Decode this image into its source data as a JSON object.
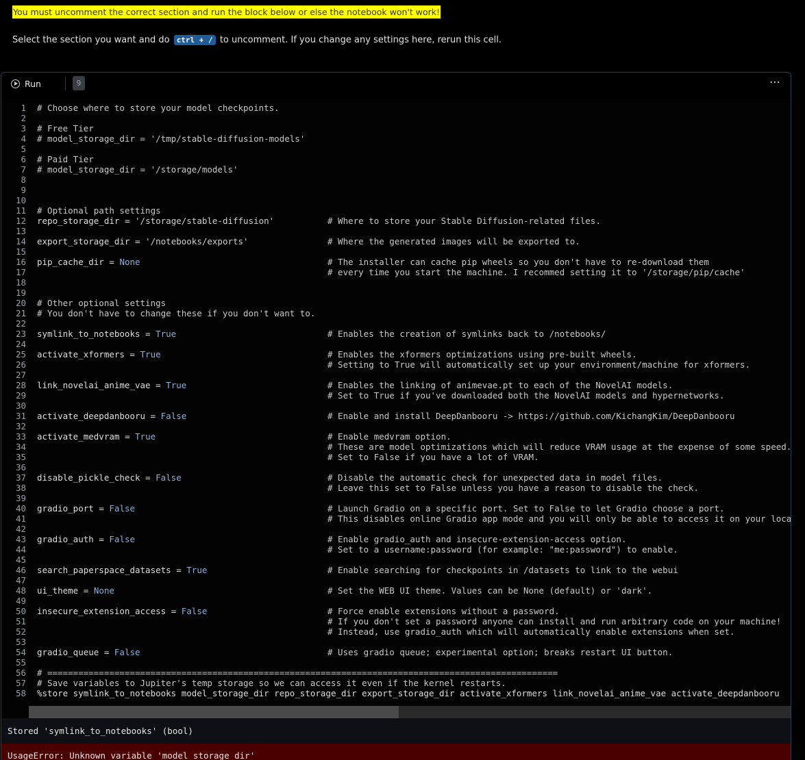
{
  "banner": "You must uncomment the correct section and run the block below or else the notebook won't work!",
  "instruction": {
    "before": "Select the section you want and do",
    "kbd": "ctrl + /",
    "after": "to uncomment. If you change any settings here, rerun this cell."
  },
  "cell": {
    "run_label": "Run",
    "exec_count": "9",
    "more_label": "⋯"
  },
  "code_lines": [
    {
      "n": "1",
      "code": "# Choose where to store your model checkpoints.",
      "type": "comment"
    },
    {
      "n": "2",
      "code": "",
      "type": "blank"
    },
    {
      "n": "3",
      "code": "# Free Tier",
      "type": "comment"
    },
    {
      "n": "4",
      "code": "# model_storage_dir = '/tmp/stable-diffusion-models'",
      "type": "comment"
    },
    {
      "n": "5",
      "code": "",
      "type": "blank"
    },
    {
      "n": "6",
      "code": "# Paid Tier",
      "type": "comment"
    },
    {
      "n": "7",
      "code": "# model_storage_dir = '/storage/models'",
      "type": "comment"
    },
    {
      "n": "8",
      "code": "",
      "type": "blank"
    },
    {
      "n": "9",
      "code": "",
      "type": "blank"
    },
    {
      "n": "10",
      "code": "",
      "type": "blank"
    },
    {
      "n": "11",
      "code": "# Optional path settings",
      "type": "comment"
    },
    {
      "n": "12",
      "code": "repo_storage_dir = '/storage/stable-diffusion'",
      "type": "assign",
      "comment": "# Where to store your Stable Diffusion-related files."
    },
    {
      "n": "13",
      "code": "",
      "type": "blank"
    },
    {
      "n": "14",
      "code": "export_storage_dir = '/notebooks/exports'",
      "type": "assign",
      "comment": "# Where the generated images will be exported to."
    },
    {
      "n": "15",
      "code": "",
      "type": "blank"
    },
    {
      "n": "16",
      "code": "pip_cache_dir = None",
      "type": "assign",
      "comment": "# The installer can cache pip wheels so you don't have to re-download them"
    },
    {
      "n": "17",
      "code": "",
      "type": "blank",
      "comment": "# every time you start the machine. I recommed setting it to '/storage/pip/cache'"
    },
    {
      "n": "18",
      "code": "",
      "type": "blank"
    },
    {
      "n": "19",
      "code": "",
      "type": "blank"
    },
    {
      "n": "20",
      "code": "# Other optional settings",
      "type": "comment"
    },
    {
      "n": "21",
      "code": "# You don't have to change these if you don't want to.",
      "type": "comment"
    },
    {
      "n": "22",
      "code": "",
      "type": "blank"
    },
    {
      "n": "23",
      "code": "symlink_to_notebooks = True",
      "type": "assign",
      "comment": "# Enables the creation of symlinks back to /notebooks/"
    },
    {
      "n": "24",
      "code": "",
      "type": "blank"
    },
    {
      "n": "25",
      "code": "activate_xformers = True",
      "type": "assign",
      "comment": "# Enables the xformers optimizations using pre-built wheels."
    },
    {
      "n": "26",
      "code": "",
      "type": "blank",
      "comment": "# Setting to True will automatically set up your environment/machine for xformers."
    },
    {
      "n": "27",
      "code": "",
      "type": "blank"
    },
    {
      "n": "28",
      "code": "link_novelai_anime_vae = True",
      "type": "assign",
      "comment": "# Enables the linking of animevae.pt to each of the NovelAI models."
    },
    {
      "n": "29",
      "code": "",
      "type": "blank",
      "comment": "# Set to True if you've downloaded both the NovelAI models and hypernetworks."
    },
    {
      "n": "30",
      "code": "",
      "type": "blank"
    },
    {
      "n": "31",
      "code": "activate_deepdanbooru = False",
      "type": "assign",
      "comment": "# Enable and install DeepDanbooru -> https://github.com/KichangKim/DeepDanbooru"
    },
    {
      "n": "32",
      "code": "",
      "type": "blank"
    },
    {
      "n": "33",
      "code": "activate_medvram = True",
      "type": "assign",
      "comment": "# Enable medvram option."
    },
    {
      "n": "34",
      "code": "",
      "type": "blank",
      "comment": "# These are model optimizations which will reduce VRAM usage at the expense of some speed."
    },
    {
      "n": "35",
      "code": "",
      "type": "blank",
      "comment": "# Set to False if you have a lot of VRAM."
    },
    {
      "n": "36",
      "code": "",
      "type": "blank"
    },
    {
      "n": "37",
      "code": "disable_pickle_check = False",
      "type": "assign",
      "comment": "# Disable the automatic check for unexpected data in model files."
    },
    {
      "n": "38",
      "code": "",
      "type": "blank",
      "comment": "# Leave this set to False unless you have a reason to disable the check."
    },
    {
      "n": "39",
      "code": "",
      "type": "blank"
    },
    {
      "n": "40",
      "code": "gradio_port = False",
      "type": "assign",
      "comment": "# Launch Gradio on a specific port. Set to False to let Gradio choose a port."
    },
    {
      "n": "41",
      "code": "",
      "type": "blank",
      "comment": "# This disables online Gradio app mode and you will only be able to access it on your local network."
    },
    {
      "n": "42",
      "code": "",
      "type": "blank"
    },
    {
      "n": "43",
      "code": "gradio_auth = False",
      "type": "assign",
      "comment": "# Enable gradio_auth and insecure-extension-access option."
    },
    {
      "n": "44",
      "code": "",
      "type": "blank",
      "comment": "# Set to a username:password (for example: \"me:password\") to enable."
    },
    {
      "n": "45",
      "code": "",
      "type": "blank"
    },
    {
      "n": "46",
      "code": "search_paperspace_datasets = True",
      "type": "assign",
      "comment": "# Enable searching for checkpoints in /datasets to link to the webui"
    },
    {
      "n": "47",
      "code": "",
      "type": "blank"
    },
    {
      "n": "48",
      "code": "ui_theme = None",
      "type": "assign",
      "comment": "# Set the WEB UI theme. Values can be None (default) or 'dark'."
    },
    {
      "n": "49",
      "code": "",
      "type": "blank"
    },
    {
      "n": "50",
      "code": "insecure_extension_access = False",
      "type": "assign",
      "comment": "# Force enable extensions without a password."
    },
    {
      "n": "51",
      "code": "",
      "type": "blank",
      "comment": "# If you don't set a password anyone can install and run arbitrary code on your machine!"
    },
    {
      "n": "52",
      "code": "",
      "type": "blank",
      "comment": "# Instead, use gradio_auth which will automatically enable extensions when set."
    },
    {
      "n": "53",
      "code": "",
      "type": "blank"
    },
    {
      "n": "54",
      "code": "gradio_queue = False",
      "type": "assign",
      "comment": "# Uses gradio queue; experimental option; breaks restart UI button."
    },
    {
      "n": "55",
      "code": "",
      "type": "blank"
    },
    {
      "n": "56",
      "code": "# ===================================================================================================",
      "type": "comment"
    },
    {
      "n": "57",
      "code": "# Save variables to Jupiter's temp storage so we can access it even if the kernel restarts.",
      "type": "comment"
    },
    {
      "n": "58",
      "code": "%store symlink_to_notebooks model_storage_dir repo_storage_dir export_storage_dir activate_xformers link_novelai_anime_vae activate_deepdanbooru",
      "type": "magic"
    }
  ],
  "output": {
    "stored": "Stored 'symlink_to_notebooks' (bool)",
    "error": "UsageError: Unknown variable 'model_storage_dir'"
  }
}
